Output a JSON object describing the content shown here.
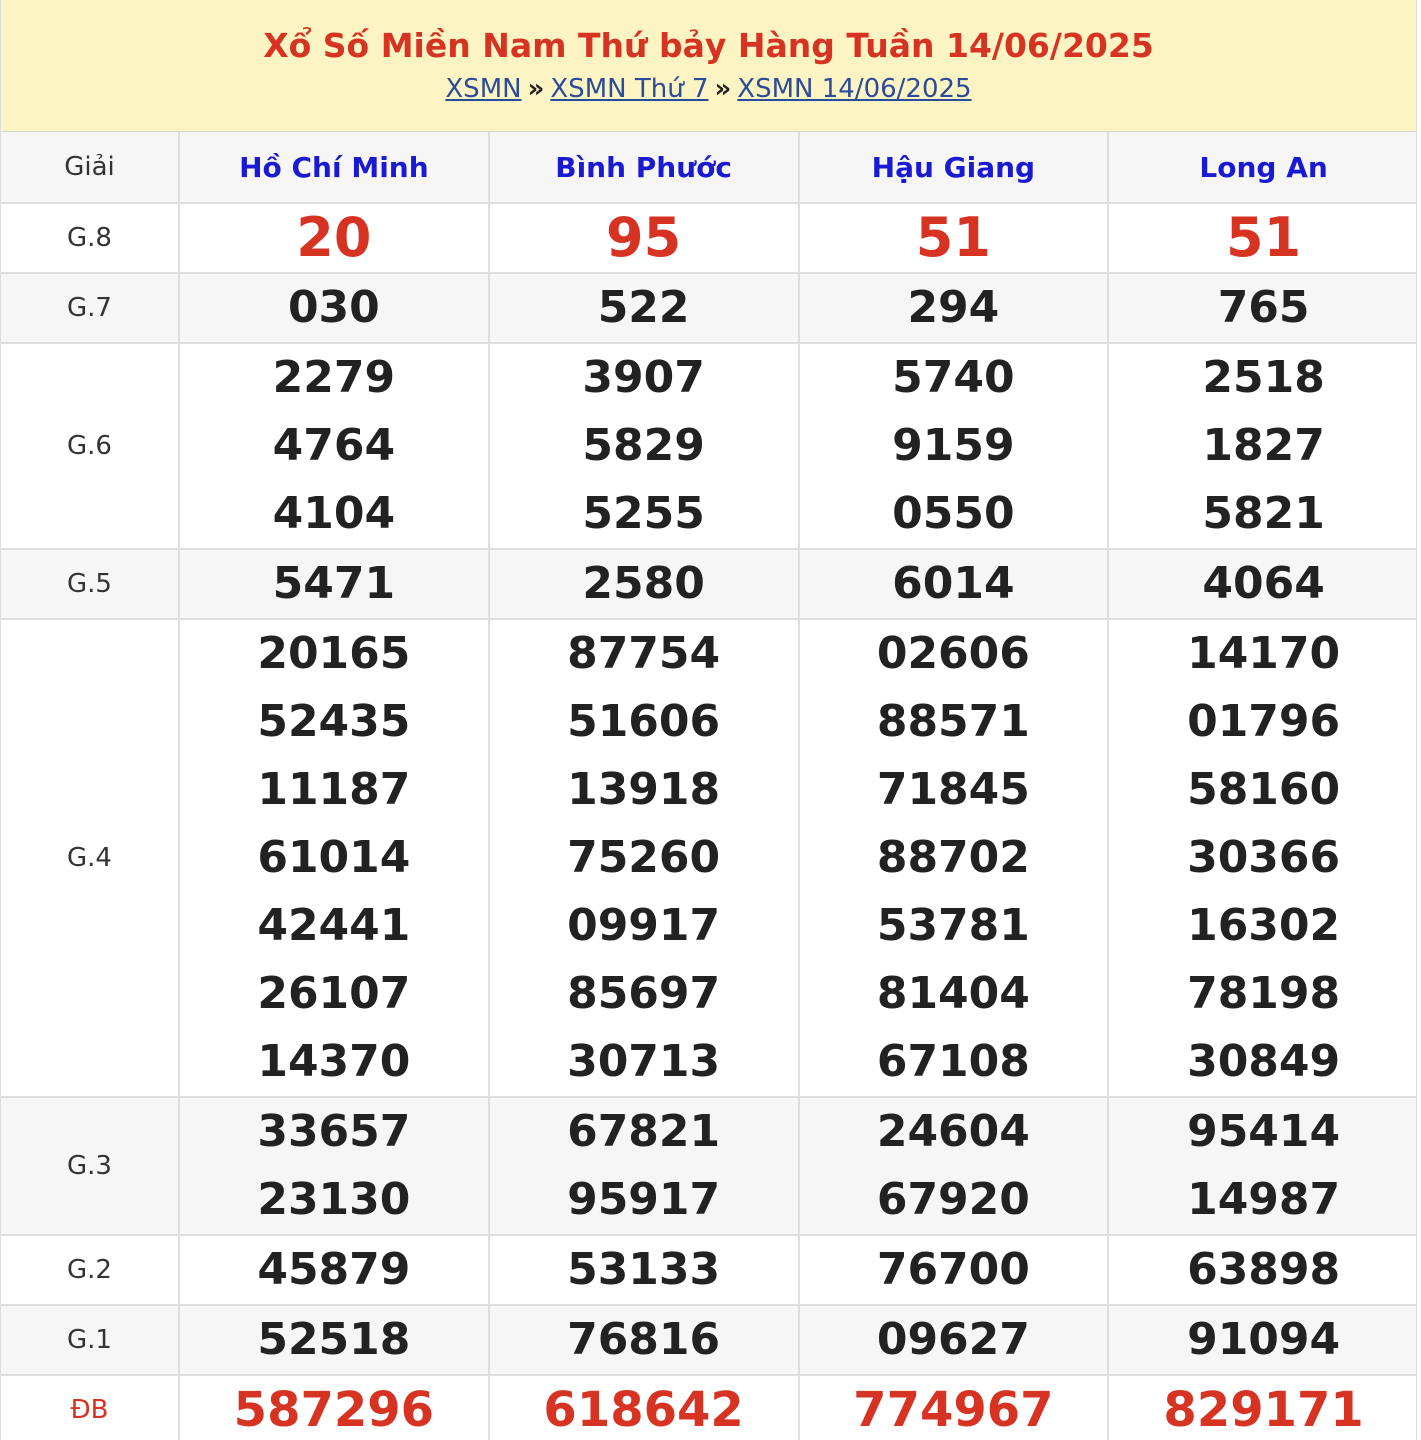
{
  "header": {
    "title": "Xổ Số Miền Nam Thứ bảy Hàng Tuần 14/06/2025",
    "breadcrumb": [
      "XSMN",
      "XSMN Thứ 7",
      "XSMN 14/06/2025"
    ],
    "separator": "»"
  },
  "table": {
    "label_header": "Giải",
    "provinces": [
      "Hồ Chí Minh",
      "Bình Phước",
      "Hậu Giang",
      "Long An"
    ],
    "prizes": [
      {
        "label": "G.8",
        "results": [
          [
            "20"
          ],
          [
            "95"
          ],
          [
            "51"
          ],
          [
            "51"
          ]
        ]
      },
      {
        "label": "G.7",
        "results": [
          [
            "030"
          ],
          [
            "522"
          ],
          [
            "294"
          ],
          [
            "765"
          ]
        ]
      },
      {
        "label": "G.6",
        "results": [
          [
            "2279",
            "4764",
            "4104"
          ],
          [
            "3907",
            "5829",
            "5255"
          ],
          [
            "5740",
            "9159",
            "0550"
          ],
          [
            "2518",
            "1827",
            "5821"
          ]
        ]
      },
      {
        "label": "G.5",
        "results": [
          [
            "5471"
          ],
          [
            "2580"
          ],
          [
            "6014"
          ],
          [
            "4064"
          ]
        ]
      },
      {
        "label": "G.4",
        "results": [
          [
            "20165",
            "52435",
            "11187",
            "61014",
            "42441",
            "26107",
            "14370"
          ],
          [
            "87754",
            "51606",
            "13918",
            "75260",
            "09917",
            "85697",
            "30713"
          ],
          [
            "02606",
            "88571",
            "71845",
            "88702",
            "53781",
            "81404",
            "67108"
          ],
          [
            "14170",
            "01796",
            "58160",
            "30366",
            "16302",
            "78198",
            "30849"
          ]
        ]
      },
      {
        "label": "G.3",
        "results": [
          [
            "33657",
            "23130"
          ],
          [
            "67821",
            "95917"
          ],
          [
            "24604",
            "67920"
          ],
          [
            "95414",
            "14987"
          ]
        ]
      },
      {
        "label": "G.2",
        "results": [
          [
            "45879"
          ],
          [
            "53133"
          ],
          [
            "76700"
          ],
          [
            "63898"
          ]
        ]
      },
      {
        "label": "G.1",
        "results": [
          [
            "52518"
          ],
          [
            "76816"
          ],
          [
            "09627"
          ],
          [
            "91094"
          ]
        ]
      },
      {
        "label": "ĐB",
        "results": [
          [
            "587296"
          ],
          [
            "618642"
          ],
          [
            "774967"
          ],
          [
            "829171"
          ]
        ]
      }
    ]
  },
  "colors": {
    "accent": "#d73323",
    "province": "#1a1ad2",
    "link": "#2b4b9b",
    "banner": "#fdf4c3"
  }
}
